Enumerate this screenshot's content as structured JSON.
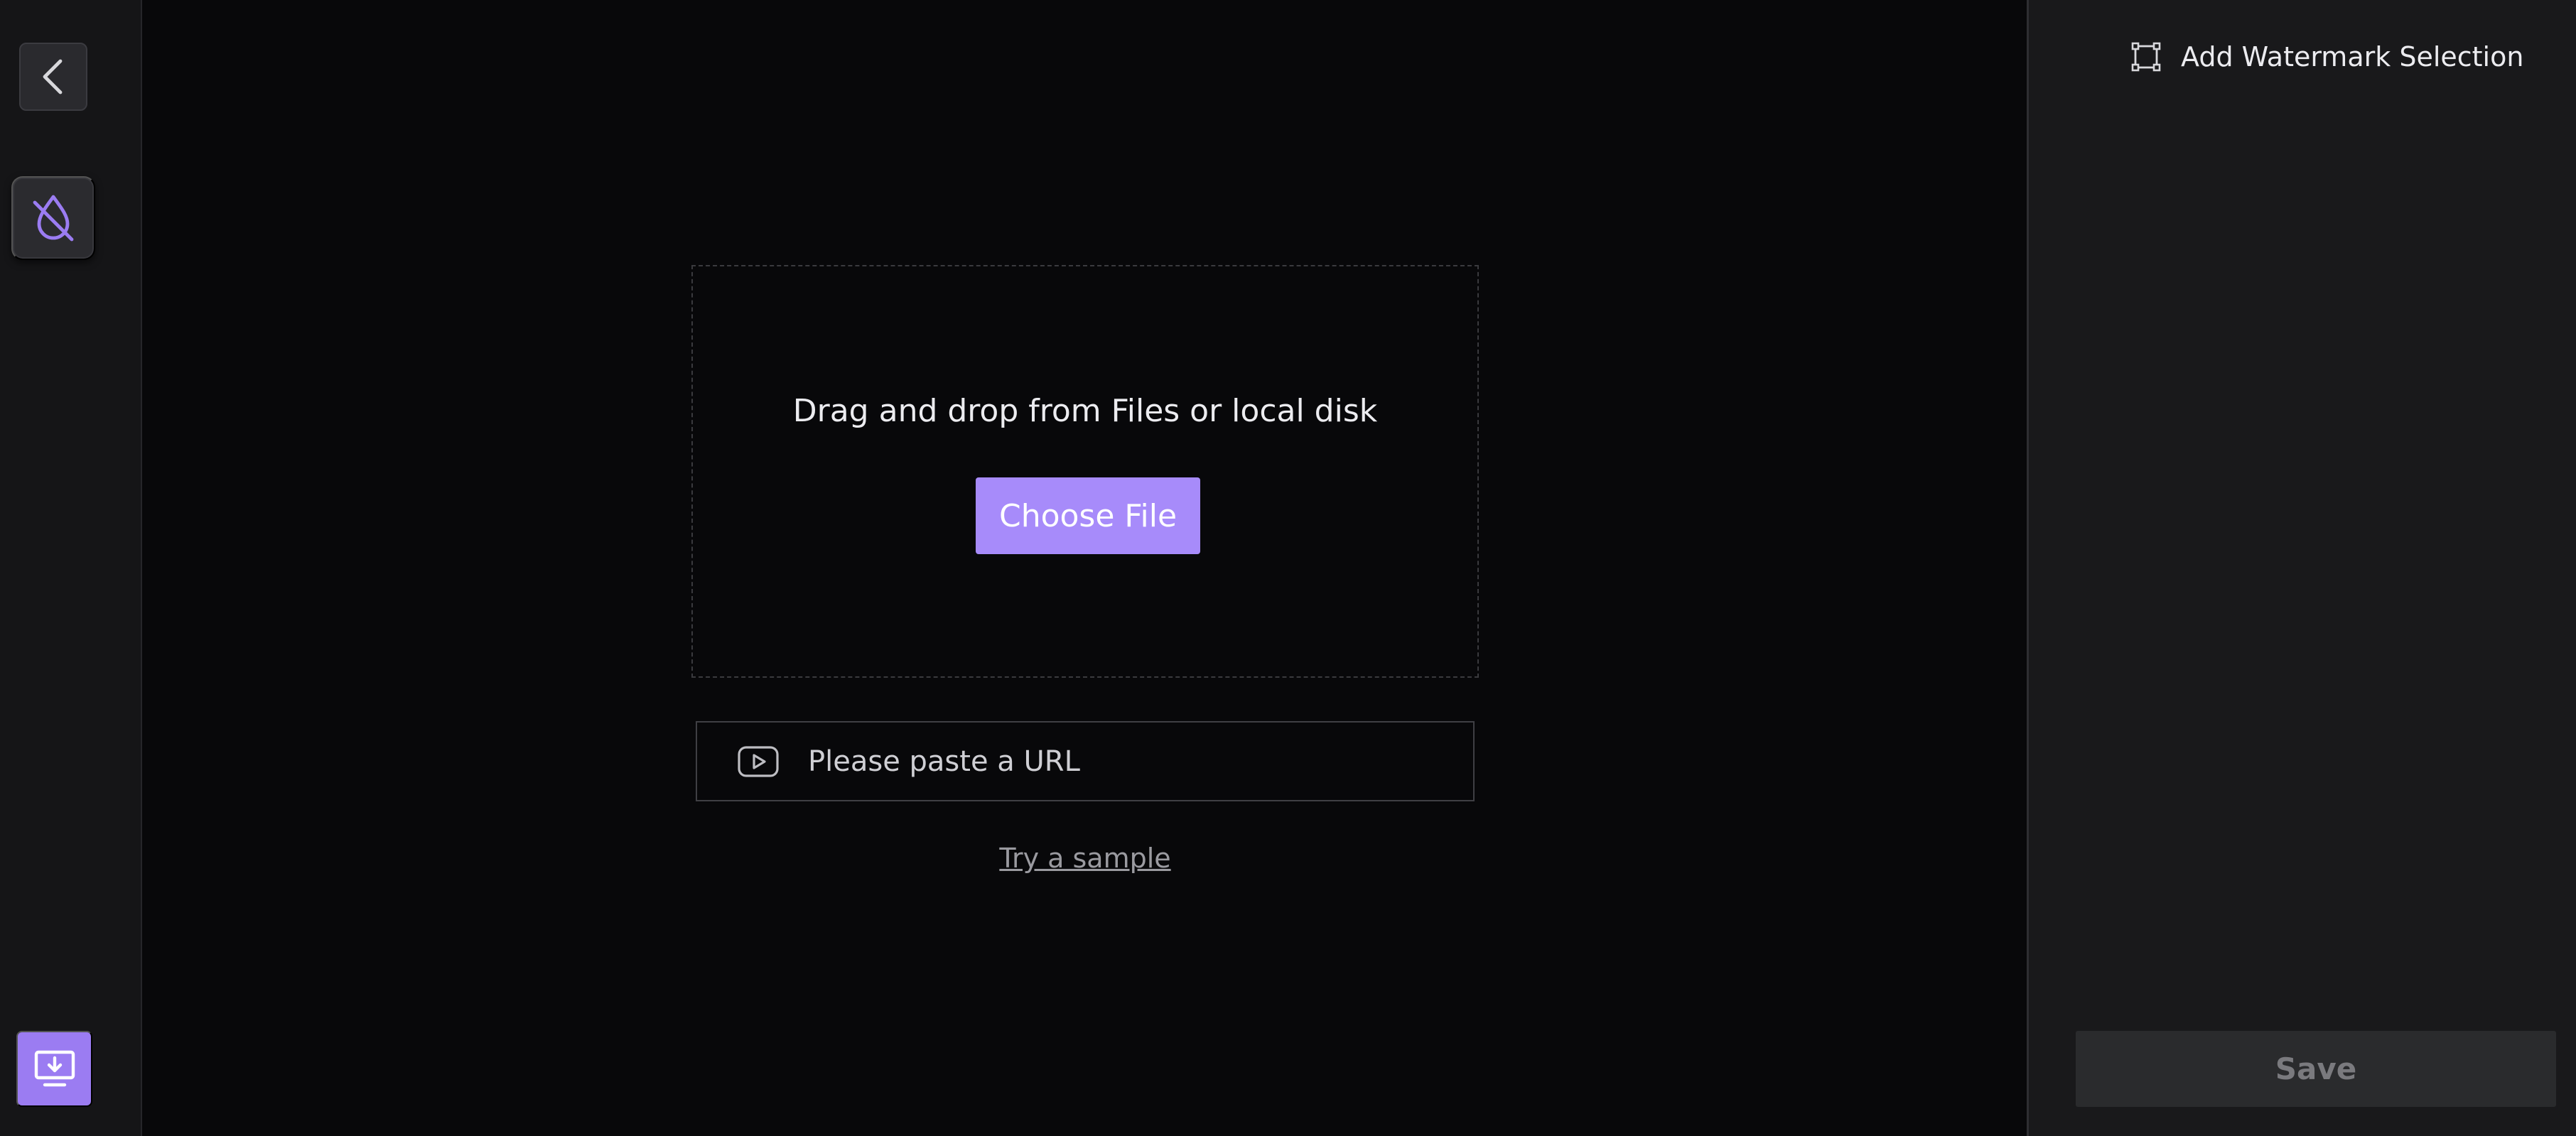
{
  "sidebar": {
    "back_icon": "chevron-left-icon",
    "tool_icon": "no-watermark-drop-icon",
    "download_icon": "screen-download-icon",
    "accent": "#9b7cf2"
  },
  "upload": {
    "drop_text": "Drag and drop from Files or local disk",
    "choose_label": "Choose File",
    "url_placeholder": "Please paste a URL",
    "url_value": "",
    "url_icon": "video-play-icon",
    "sample_label": "Try a sample"
  },
  "panel": {
    "add_selection_label": "Add Watermark Selection",
    "add_selection_icon": "selection-frame-icon",
    "save_label": "Save"
  },
  "colors": {
    "background": "#08080a",
    "primary_button": "#a78bfa",
    "panel": "#19191b"
  }
}
